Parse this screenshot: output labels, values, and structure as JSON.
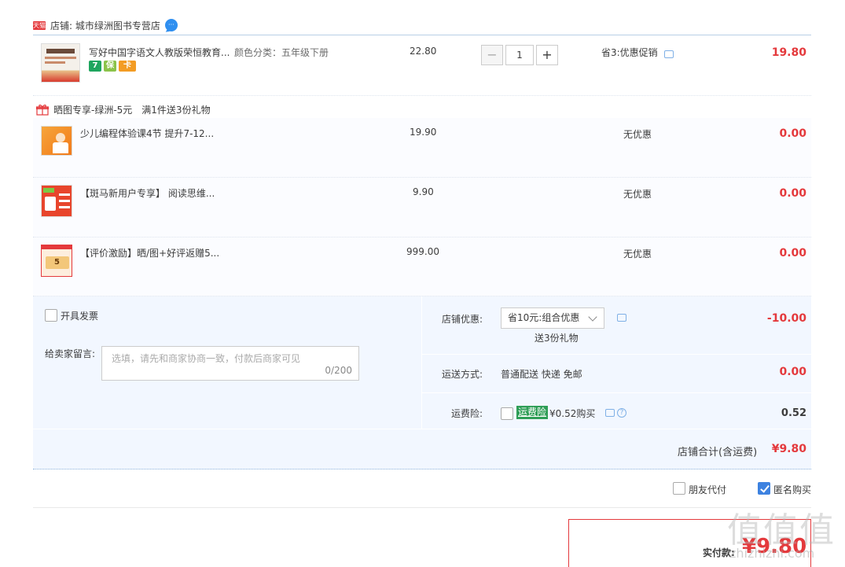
{
  "store": {
    "badge": "天猫",
    "name": "店铺: 城市绿洲图书专营店"
  },
  "items": [
    {
      "title": "写好中国字语文人教版荣恒教育...",
      "sku": "颜色分类：五年级下册",
      "price": "22.80",
      "quantity": "1",
      "promo": "省3:优惠促销",
      "subtotal": "19.80",
      "tags": [
        "7",
        "保",
        "卡"
      ]
    },
    {
      "title": "少儿编程体验课4节 提升7-12...",
      "price": "19.90",
      "promo": "无优惠",
      "subtotal": "0.00"
    },
    {
      "title": "【斑马新用户专享】 阅读思维...",
      "price": "9.90",
      "promo": "无优惠",
      "subtotal": "0.00"
    },
    {
      "title": "【评价激励】晒/图+好评返赠5...",
      "price": "999.00",
      "promo": "无优惠",
      "subtotal": "0.00"
    }
  ],
  "gift": {
    "label": "晒图专享-绿洲-5元",
    "rule": "满1件送3份礼物"
  },
  "invoice": {
    "label": "开具发票",
    "checked": false
  },
  "message": {
    "label": "给卖家留言:",
    "placeholder": "选填，请先和商家协商一致，付款后商家可见",
    "counter": "0/200"
  },
  "store_discount": {
    "label": "店铺优惠:",
    "selected": "省10元:组合优惠",
    "note": "送3份礼物",
    "amount": "-10.00"
  },
  "shipping": {
    "label": "运送方式:",
    "value": "普通配送 快递 免邮",
    "amount": "0.00"
  },
  "freight_insurance": {
    "label": "运费险:",
    "tag": "运费险",
    "value": "¥0.52购买",
    "amount": "0.52"
  },
  "store_total": {
    "label": "店铺合计(含运费)",
    "amount": "¥9.80"
  },
  "options": {
    "friend_pay": "朋友代付",
    "friend_pay_checked": false,
    "anonymous": "匿名购买",
    "anonymous_checked": true
  },
  "payment": {
    "label": "实付款:",
    "amount": "¥9.80"
  },
  "watermark": {
    "text": "值值值",
    "sub": "zhizhizhi.com"
  },
  "colors": {
    "accent_red": "#e4393c",
    "panel_bg": "#f2f7ff",
    "link_blue": "#3d82e0",
    "insurance_green": "#2f9e57"
  }
}
